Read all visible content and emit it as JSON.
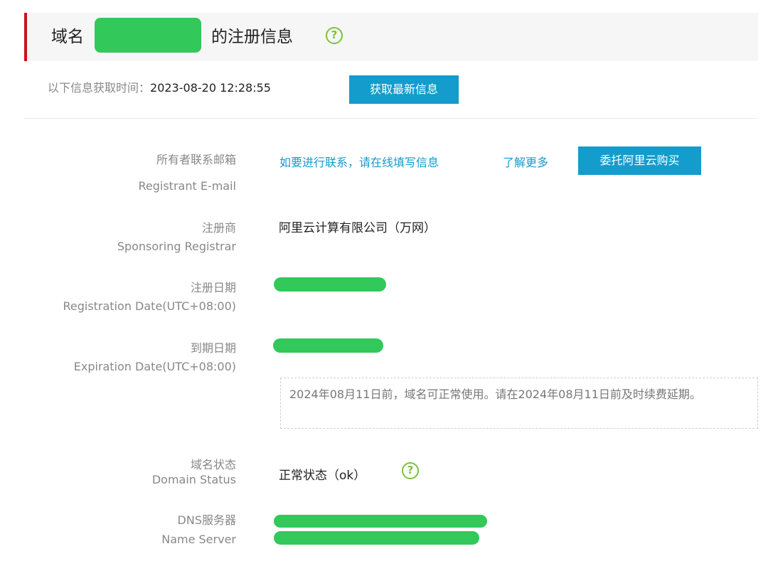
{
  "colors": {
    "accent": "#149ccd",
    "redact": "#32c85a",
    "help": "#7ac23c",
    "header_bar": "#c7141a"
  },
  "header": {
    "title_prefix": "域名",
    "title_suffix": "的注册信息",
    "help_icon": "question-circle-icon"
  },
  "fetch": {
    "label": "以下信息获取时间：",
    "time": "2023-08-20 12:28:55",
    "refresh_button": "获取最新信息"
  },
  "fields": {
    "email": {
      "label_cn": "所有者联系邮箱",
      "label_en": "Registrant E-mail",
      "contact_link": "如要进行联系，请在线填写信息",
      "learn_more": "了解更多",
      "entrust_button": "委托阿里云购买"
    },
    "registrar": {
      "label_cn": "注册商",
      "label_en": "Sponsoring Registrar",
      "value": "阿里云计算有限公司（万网）"
    },
    "reg_date": {
      "label_cn": "注册日期",
      "label_en": "Registration Date(UTC+08:00)"
    },
    "exp_date": {
      "label_cn": "到期日期",
      "label_en": "Expiration Date(UTC+08:00)",
      "notice": "2024年08月11日前，域名可正常使用。请在2024年08月11日前及时续费延期。"
    },
    "status": {
      "label_cn": "域名状态",
      "label_en": "Domain Status",
      "value": "正常状态（ok）",
      "help_icon": "question-circle-icon"
    },
    "dns": {
      "label_cn": "DNS服务器",
      "label_en": "Name Server"
    }
  }
}
